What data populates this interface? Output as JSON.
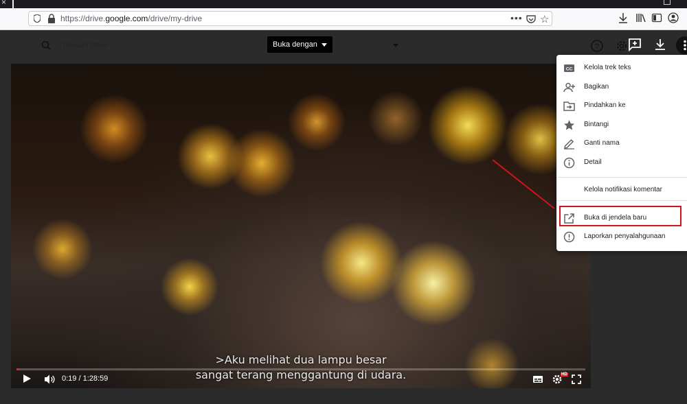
{
  "browser": {
    "url_prefix": "https://drive.",
    "url_domain": "google.com",
    "url_path": "/drive/my-drive",
    "more_dots": "•••"
  },
  "drive": {
    "search_placeholder": "Telusuri Drive",
    "open_with_label": "Buka dengan"
  },
  "video": {
    "subtitle_line1": ">Aku melihat dua lampu besar",
    "subtitle_line2": "sangat terang menggantung di udara.",
    "time": "0:19 / 1:28:59",
    "progress": 0.0036,
    "hd": "HD"
  },
  "menu": {
    "items": [
      {
        "label": "Kelola trek teks",
        "icon": "closed-captions-icon"
      },
      {
        "label": "Bagikan",
        "icon": "add-person-icon"
      },
      {
        "label": "Pindahkan ke",
        "icon": "move-folder-icon"
      },
      {
        "label": "Bintangi",
        "icon": "star-icon"
      },
      {
        "label": "Ganti nama",
        "icon": "pencil-icon"
      },
      {
        "label": "Detail",
        "icon": "info-icon"
      },
      {
        "label": "Kelola notifikasi komentar",
        "icon": ""
      },
      {
        "label": "Buka di jendela baru",
        "icon": "open-in-new-icon"
      },
      {
        "label": "Laporkan penyalahgunaan",
        "icon": "report-icon"
      }
    ]
  },
  "colors": {
    "annotation_red": "#d1141b",
    "progress_red": "#e22"
  }
}
